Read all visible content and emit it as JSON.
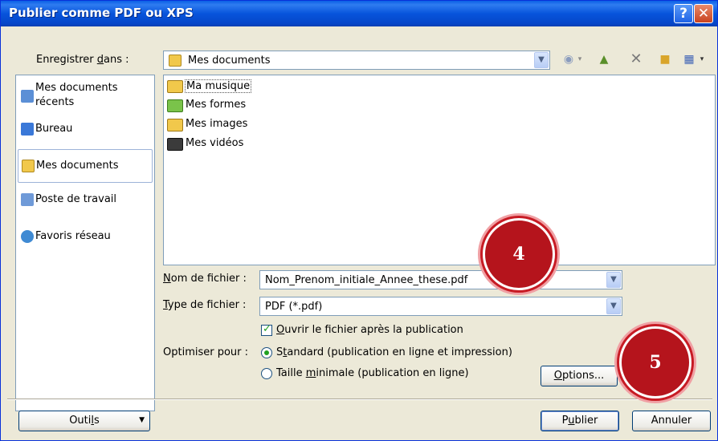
{
  "window": {
    "title": "Publier comme PDF ou XPS",
    "help_button": "?",
    "close_button": "✕"
  },
  "save_in": {
    "label_prefix": "Enregistrer ",
    "label_accel": "d",
    "label_suffix": "ans :",
    "value": "Mes documents"
  },
  "toolbar": {
    "back_icon": "back-icon",
    "up_icon": "up-folder-icon",
    "delete_icon": "delete-icon",
    "new_folder_icon": "new-folder-icon",
    "views_icon": "views-icon"
  },
  "places": [
    {
      "label_line1": "Mes documents",
      "label_line2": "récents",
      "icon": "recent-documents-icon",
      "color": "#5b8fd6"
    },
    {
      "label_line1": "Bureau",
      "label_line2": "",
      "icon": "desktop-icon",
      "color": "#3a78d8"
    },
    {
      "label_line1": "Mes documents",
      "label_line2": "",
      "icon": "my-documents-icon",
      "color": "#f1c84b"
    },
    {
      "label_line1": "Poste de travail",
      "label_line2": "",
      "icon": "my-computer-icon",
      "color": "#6f9ad8"
    },
    {
      "label_line1": "Favoris réseau",
      "label_line2": "",
      "icon": "network-places-icon",
      "color": "#3f8ad3"
    }
  ],
  "files": [
    {
      "name": "Ma musique",
      "icon": "music-folder-icon"
    },
    {
      "name": "Mes formes",
      "icon": "shapes-folder-icon"
    },
    {
      "name": "Mes images",
      "icon": "pictures-folder-icon"
    },
    {
      "name": "Mes vidéos",
      "icon": "videos-folder-icon"
    }
  ],
  "filename": {
    "label_accel": "N",
    "label_rest": "om de fichier :",
    "value": "Nom_Prenom_initiale_Annee_these.pdf"
  },
  "filetype": {
    "label_accel": "T",
    "label_rest": "ype de fichier :",
    "value": "PDF (*.pdf)"
  },
  "open_after": {
    "label_accel": "O",
    "label_rest": "uvrir le fichier après la publication",
    "checked": true
  },
  "optimize": {
    "label": "Optimiser pour :",
    "standard_prefix": "S",
    "standard_accel": "t",
    "standard_rest": "andard (publication en ligne et impression)",
    "minimal_prefix": "Taille ",
    "minimal_accel": "m",
    "minimal_rest": "inimale (publication en ligne)",
    "selected": "standard"
  },
  "buttons": {
    "options_accel": "O",
    "options_rest": "ptions...",
    "tools_prefix": "Outi",
    "tools_accel": "l",
    "tools_rest": "s",
    "publish_prefix": "P",
    "publish_accel": "u",
    "publish_rest": "blier",
    "cancel": "Annuler"
  },
  "markers": {
    "step4": "4",
    "step5": "5",
    "color": "#b5141c"
  }
}
